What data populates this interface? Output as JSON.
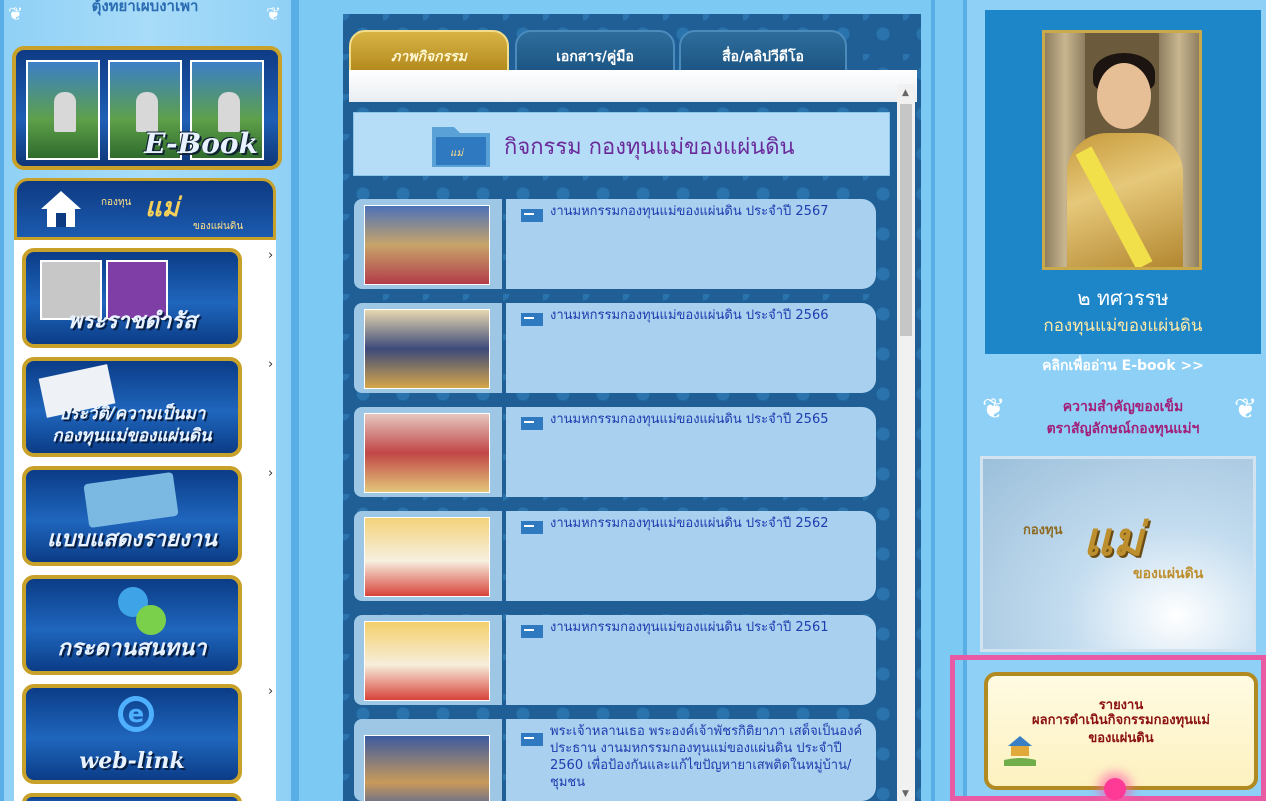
{
  "left_sidebar": {
    "header": "ตุ้งทยาเผบงาเพา",
    "ebook_label": "E-Book",
    "home_logo_text": "แม่",
    "home_logo_prefix": "กองทุน",
    "home_logo_sub": "ของแผ่นดิน",
    "menu": [
      {
        "caption": "พระราชดำรัส",
        "has_submenu": true
      },
      {
        "caption": "ประวัติ/ความเป็นมา",
        "caption2": "กองทุนแม่ของแผ่นดิน",
        "has_submenu": true
      },
      {
        "caption": "แบบแสดงรายงาน",
        "has_submenu": true
      },
      {
        "caption": "กระดานสนทนา",
        "has_submenu": false
      },
      {
        "caption": "web-link",
        "has_submenu": true
      }
    ],
    "chevron": "›"
  },
  "center": {
    "tabs": [
      {
        "label": "ภาพกิจกรรม",
        "active": true
      },
      {
        "label": "เอกสาร/คู่มือ",
        "active": false
      },
      {
        "label": "สื่อ/คลิปวีดีโอ",
        "active": false
      }
    ],
    "section_title": "กิจกรรม กองทุนแม่ของแผ่นดิน",
    "items": [
      {
        "text": "งานมหกรรมกองทุนแม่ของแผ่นดิน ประจำปี 2567"
      },
      {
        "text": "งานมหกรรมกองทุนแม่ของแผ่นดิน ประจำปี 2566"
      },
      {
        "text": "งานมหกรรมกองทุนแม่ของแผ่นดิน ประจำปี 2565"
      },
      {
        "text": "งานมหกรรมกองทุนแม่ของแผ่นดิน ประจำปี 2562"
      },
      {
        "text": "งานมหกรรมกองทุนแม่ของแผ่นดิน ประจำปี 2561"
      },
      {
        "text": "พระเจ้าหลานเธอ พระองค์เจ้าพัชรกิติยาภา เสด็จเป็นองค์ประธาน งานมหกรรมกองทุนแม่ของแผ่นดิน ประจำปี 2560 เพื่อป้องกันและแก้ไขปัญหายาเสพติดในหมู่บ้าน/ชุมชน"
      }
    ]
  },
  "right_sidebar": {
    "banner_title": "๒ ทศวรรษ",
    "banner_subtitle": "กองทุนแม่ของแผ่นดิน",
    "ebook_link": "คลิกเพื่ออ่าน E-book >>",
    "importance_line1": "ความสำคัญของเข็ม",
    "importance_line2": "ตราสัญลักษณ์กองทุนแม่ฯ",
    "video_logo": "แม่",
    "video_prefix": "กองทุน",
    "video_sub": "ของแผ่นดิน",
    "report_line1": "รายงาน",
    "report_line2": "ผลการดำเนินกิจกรรมกองทุนแม่",
    "report_line3": "ของแผ่นดิน"
  },
  "colors": {
    "background": "#6dbdf0",
    "panel": "#1f5f96",
    "gold": "#c8a12a",
    "link_text": "#1d3db0",
    "section_title": "#6a2a9a",
    "highlight": "#e85aa3"
  }
}
